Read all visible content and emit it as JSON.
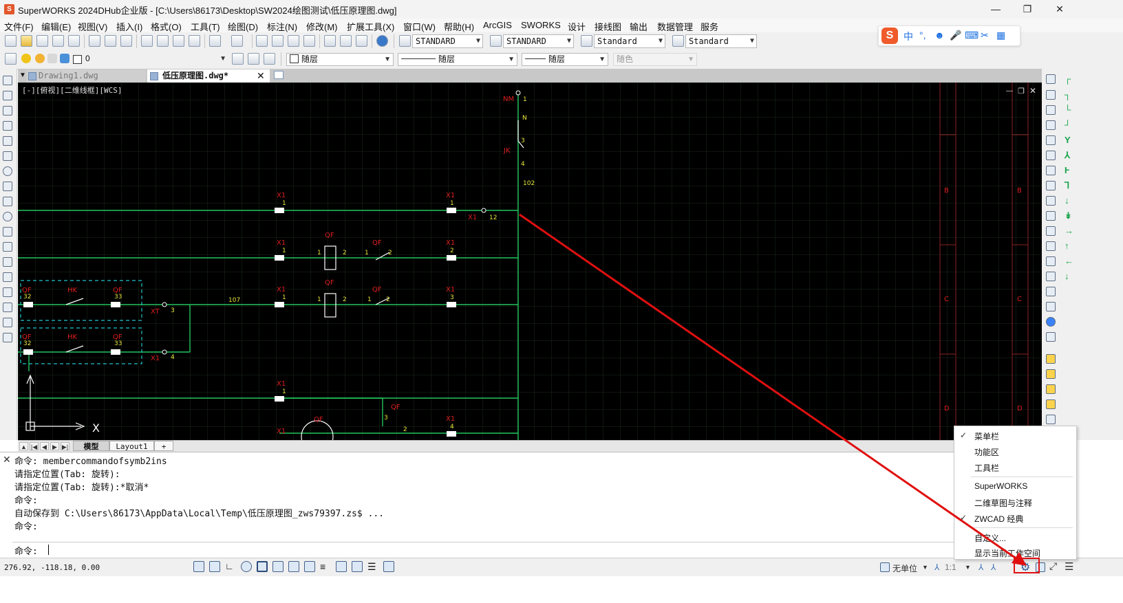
{
  "window": {
    "title": "SuperWORKS 2024DHub企业版 - [C:\\Users\\86173\\Desktop\\SW2024绘图测试\\低压原理图.dwg]",
    "controls": [
      "—",
      "❐",
      "✕"
    ]
  },
  "menubar": {
    "items": [
      "文件(F)",
      "编辑(E)",
      "视图(V)",
      "插入(I)",
      "格式(O)",
      "工具(T)",
      "绘图(D)",
      "标注(N)",
      "修改(M)",
      "扩展工具(X)",
      "窗口(W)",
      "帮助(H)",
      "ArcGIS",
      "SWORKS",
      "设计",
      "接线图",
      "输出",
      "数据管理",
      "服务"
    ]
  },
  "toolbar1": {
    "text_style": "STANDARD",
    "dim_style": "STANDARD",
    "table_style": "Standard",
    "multileader_style": "Standard"
  },
  "toolbar2": {
    "layer": "0",
    "color": "随层",
    "linetype": "随层",
    "lineweight": "随层",
    "plotstyle": "随色"
  },
  "ime": {
    "logo": "S",
    "items": [
      "中",
      "°,",
      "☻",
      "🎤",
      "⌨",
      "✂",
      "▦"
    ]
  },
  "doc_tabs": [
    {
      "label": "Drawing1.dwg",
      "active": false
    },
    {
      "label": "低压原理图.dwg*",
      "active": true
    }
  ],
  "viewport": {
    "label": "[-][俯视][二维线框][WCS]"
  },
  "drawing": {
    "labels": {
      "nm": "NM",
      "n1": "1",
      "n": "N",
      "n3": "3",
      "jk": "JK",
      "n4": "4",
      "n102": "102",
      "x1": "X1",
      "n12": "12",
      "qf": "QF",
      "n2": "2",
      "n107": "107",
      "hk": "HK",
      "n32": "32",
      "n33": "33",
      "xt": "XT",
      "axis_x": "X",
      "b": "B",
      "c": "C",
      "d": "D"
    }
  },
  "layout_tabs": {
    "nav": [
      "▲",
      "|◀",
      "◀",
      "▶",
      "▶|"
    ],
    "tabs": [
      {
        "label": "模型",
        "active": true
      },
      {
        "label": "Layout1",
        "active": false
      },
      {
        "label": "+",
        "active": false
      }
    ]
  },
  "command": {
    "close": "✕",
    "history": [
      "命令: membercommandofsymb2ins",
      "请指定位置(Tab: 旋转):",
      "请指定位置(Tab: 旋转):*取消*",
      "命令:",
      "自动保存到 C:\\Users\\86173\\AppData\\Local\\Temp\\低压原理图_zws79397.zs$ ...",
      "命令:"
    ],
    "prompt": "命令:",
    "input_value": ""
  },
  "statusbar": {
    "coords": "276.92, -118.18, 0.00",
    "units": "无单位",
    "scale": "1:1"
  },
  "context_menu": {
    "items": [
      {
        "label": "菜单栏",
        "checked": true
      },
      {
        "label": "功能区",
        "checked": false
      },
      {
        "label": "工具栏",
        "checked": false
      },
      {
        "label": "SuperWORKS",
        "checked": false
      },
      {
        "label": "二维草图与注释",
        "checked": false
      },
      {
        "label": "ZWCAD 经典",
        "checked": true
      },
      {
        "label": "自定义...",
        "checked": false
      },
      {
        "label": "显示当前工作空间",
        "checked": false
      }
    ],
    "check_mark": "✓"
  },
  "colors": {
    "canvas_bg": "#000000",
    "wire": "#22c55e",
    "label_red": "#e01e1e",
    "label_yellow": "#e8e63a",
    "annotation": "#e01010",
    "dashed_box": "#22c3cc"
  }
}
